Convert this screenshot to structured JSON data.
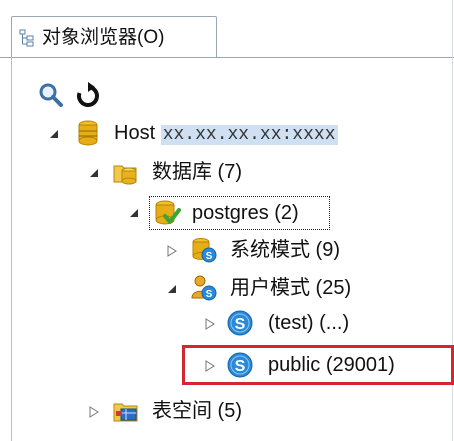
{
  "tab": {
    "label": "对象浏览器(O)"
  },
  "toolbar": {
    "search": "search-icon",
    "refresh": "refresh-icon"
  },
  "tree": {
    "host": {
      "label": "Host",
      "address": "xx.xx.xx.xx:xxxx"
    },
    "databases": {
      "label": "数据库 (7)"
    },
    "postgres": {
      "label": "postgres (2)"
    },
    "system_schemas": {
      "label": "系统模式 (9)"
    },
    "user_schemas": {
      "label": "用户模式 (25)"
    },
    "test_schema": {
      "label": "(test) (...)"
    },
    "public_schema": {
      "label": "public (29001)"
    },
    "tablespaces": {
      "label": "表空间 (5)"
    }
  },
  "colors": {
    "highlight_border": "#d22733",
    "selection_background": "#cfe0f3",
    "schema_icon_blue": "#2a89d8",
    "database_icon_gold": "#e0a010"
  }
}
